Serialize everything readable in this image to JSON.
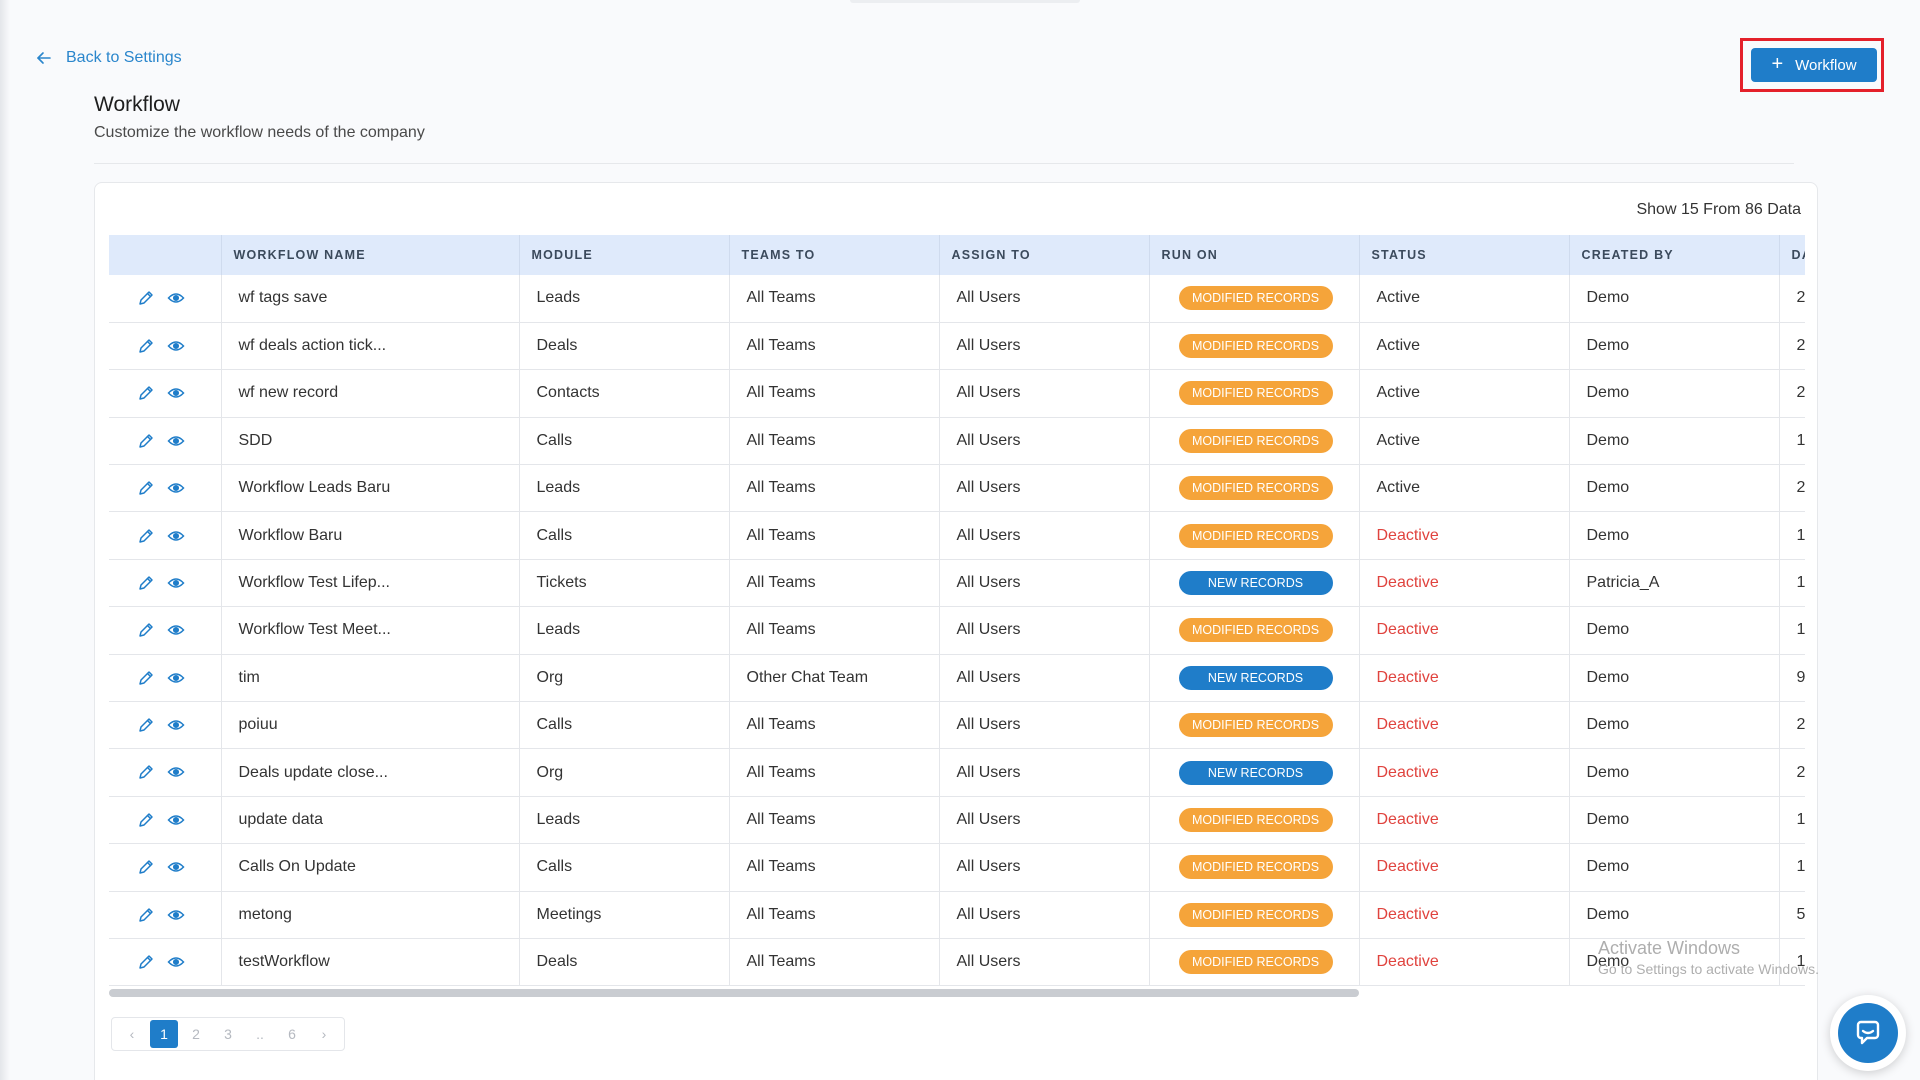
{
  "nav": {
    "back_label": "Back to Settings"
  },
  "actions": {
    "add_workflow_label": "Workflow"
  },
  "page": {
    "title": "Workflow",
    "subtitle": "Customize the workflow needs of the company",
    "data_count": "Show 15 From 86 Data"
  },
  "table": {
    "columns": [
      "",
      "WORKFLOW NAME",
      "MODULE",
      "TEAMS TO",
      "ASSIGN TO",
      "RUN ON",
      "STATUS",
      "CREATED BY",
      "DA"
    ],
    "rows": [
      {
        "name": "wf tags save",
        "module": "Leads",
        "teams": "All Teams",
        "assign": "All Users",
        "run_on": "MODIFIED RECORDS",
        "run_type": "modified",
        "status": "Active",
        "created_by": "Demo",
        "date": "2"
      },
      {
        "name": "wf deals action tick...",
        "module": "Deals",
        "teams": "All Teams",
        "assign": "All Users",
        "run_on": "MODIFIED RECORDS",
        "run_type": "modified",
        "status": "Active",
        "created_by": "Demo",
        "date": "2"
      },
      {
        "name": "wf new record",
        "module": "Contacts",
        "teams": "All Teams",
        "assign": "All Users",
        "run_on": "MODIFIED RECORDS",
        "run_type": "modified",
        "status": "Active",
        "created_by": "Demo",
        "date": "2"
      },
      {
        "name": "SDD",
        "module": "Calls",
        "teams": "All Teams",
        "assign": "All Users",
        "run_on": "MODIFIED RECORDS",
        "run_type": "modified",
        "status": "Active",
        "created_by": "Demo",
        "date": "1"
      },
      {
        "name": "Workflow Leads Baru",
        "module": "Leads",
        "teams": "All Teams",
        "assign": "All Users",
        "run_on": "MODIFIED RECORDS",
        "run_type": "modified",
        "status": "Active",
        "created_by": "Demo",
        "date": "2"
      },
      {
        "name": "Workflow Baru",
        "module": "Calls",
        "teams": "All Teams",
        "assign": "All Users",
        "run_on": "MODIFIED RECORDS",
        "run_type": "modified",
        "status": "Deactive",
        "created_by": "Demo",
        "date": "1"
      },
      {
        "name": "Workflow Test Lifep...",
        "module": "Tickets",
        "teams": "All Teams",
        "assign": "All Users",
        "run_on": "NEW RECORDS",
        "run_type": "new",
        "status": "Deactive",
        "created_by": "Patricia_A",
        "date": "1"
      },
      {
        "name": "Workflow Test Meet...",
        "module": "Leads",
        "teams": "All Teams",
        "assign": "All Users",
        "run_on": "MODIFIED RECORDS",
        "run_type": "modified",
        "status": "Deactive",
        "created_by": "Demo",
        "date": "1"
      },
      {
        "name": "tim",
        "module": "Org",
        "teams": "Other Chat Team",
        "assign": "All Users",
        "run_on": "NEW RECORDS",
        "run_type": "new",
        "status": "Deactive",
        "created_by": "Demo",
        "date": "9"
      },
      {
        "name": "poiuu",
        "module": "Calls",
        "teams": "All Teams",
        "assign": "All Users",
        "run_on": "MODIFIED RECORDS",
        "run_type": "modified",
        "status": "Deactive",
        "created_by": "Demo",
        "date": "2"
      },
      {
        "name": "Deals update close...",
        "module": "Org",
        "teams": "All Teams",
        "assign": "All Users",
        "run_on": "NEW RECORDS",
        "run_type": "new",
        "status": "Deactive",
        "created_by": "Demo",
        "date": "2"
      },
      {
        "name": "update data",
        "module": "Leads",
        "teams": "All Teams",
        "assign": "All Users",
        "run_on": "MODIFIED RECORDS",
        "run_type": "modified",
        "status": "Deactive",
        "created_by": "Demo",
        "date": "1"
      },
      {
        "name": "Calls On Update",
        "module": "Calls",
        "teams": "All Teams",
        "assign": "All Users",
        "run_on": "MODIFIED RECORDS",
        "run_type": "modified",
        "status": "Deactive",
        "created_by": "Demo",
        "date": "1"
      },
      {
        "name": "metong",
        "module": "Meetings",
        "teams": "All Teams",
        "assign": "All Users",
        "run_on": "MODIFIED RECORDS",
        "run_type": "modified",
        "status": "Deactive",
        "created_by": "Demo",
        "date": "5"
      },
      {
        "name": "testWorkflow",
        "module": "Deals",
        "teams": "All Teams",
        "assign": "All Users",
        "run_on": "MODIFIED RECORDS",
        "run_type": "modified",
        "status": "Deactive",
        "created_by": "Demo",
        "date": "1"
      }
    ]
  },
  "pagination": {
    "prev": "‹",
    "pages": [
      "1",
      "2",
      "3",
      "..",
      "6"
    ],
    "next": "›"
  },
  "watermark": {
    "line1": "Activate Windows",
    "line2": "Go to Settings to activate Windows."
  },
  "icons": {
    "back": "arrow-left-icon",
    "add": "plus-icon",
    "edit": "pencil-icon",
    "view": "eye-icon",
    "chat": "chat-icon"
  },
  "colors": {
    "primary": "#1f7dc9",
    "modified_badge": "#f5a43a",
    "new_badge": "#1f7dc9",
    "deactive": "#e0433e",
    "highlight_frame": "#e4202a",
    "header_bg": "#dfeafb"
  }
}
